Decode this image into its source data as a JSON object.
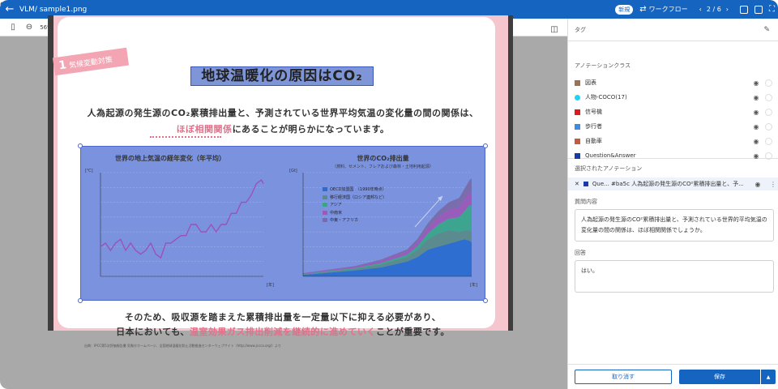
{
  "topbar": {
    "title": "VLM/ sample1.png",
    "badge": "新規",
    "workflow": "ワークフロー",
    "pager": "2 / 6",
    "back_icon": "arrow-left-icon"
  },
  "toolbar": {
    "zoom": "56%"
  },
  "document": {
    "ribbon_num": "1",
    "ribbon_text": "気候変動対策",
    "title": "地球温暖化の原因はCO₂",
    "lead_line1": "人為起源の発生源のCO₂累積排出量と、予測されている世界平均気温の変化量の間の関係は、",
    "lead_line2_highlight": "ほぼ相関関係",
    "lead_line2_rest": "にあることが明らかになっています。",
    "bottom_line1": "そのため、吸収源を踏まえた累積排出量を一定量以下に抑える必要があり、",
    "bottom_line2_pre": "日本においても、",
    "bottom_line2_highlight": "温室効果ガス排出削減を継続的に進めていく",
    "bottom_line2_post": "ことが重要です。",
    "source": "出典：IPCC第5次評価報告書 気象庁ホームページ、全国地球温暖化防止活動推進センターウェブサイト（http://www.jccca.org/）より",
    "highlight_color": "#e2708a"
  },
  "chart_data": [
    {
      "type": "line",
      "title": "世界の地上気温の経年変化（年平均）",
      "unit": "[℃]",
      "xunit": "[年]",
      "x_ticks": [
        "1850",
        "1900",
        "1950",
        "2000"
      ],
      "y_ticks": [
        "0.6",
        "0.4",
        "0.2",
        "0",
        "-0.2",
        "-0.4",
        "-0.6",
        "-0.8"
      ],
      "xlim": [
        1850,
        2012
      ],
      "ylim": [
        -0.8,
        0.6
      ],
      "series": [
        {
          "x": [
            1850,
            1855,
            1860,
            1865,
            1870,
            1875,
            1880,
            1885,
            1890,
            1895,
            1900,
            1905,
            1910,
            1915,
            1920,
            1925,
            1930,
            1935,
            1940,
            1945,
            1950,
            1955,
            1960,
            1965,
            1970,
            1975,
            1980,
            1985,
            1990,
            1995,
            2000,
            2005,
            2010,
            2012
          ],
          "y": [
            -0.4,
            -0.35,
            -0.45,
            -0.35,
            -0.3,
            -0.45,
            -0.35,
            -0.45,
            -0.5,
            -0.45,
            -0.35,
            -0.5,
            -0.55,
            -0.35,
            -0.35,
            -0.3,
            -0.25,
            -0.25,
            -0.1,
            -0.1,
            -0.2,
            -0.2,
            -0.1,
            -0.2,
            -0.1,
            -0.1,
            0.05,
            0.05,
            0.2,
            0.2,
            0.3,
            0.45,
            0.5,
            0.45
          ]
        }
      ]
    },
    {
      "type": "area",
      "title": "世界のCO₂排出量",
      "subtitle": "（燃料、セメント、フレアおよび森林・土地利用起源）",
      "unit": "[Gt]",
      "xunit": "[年]",
      "x_ticks": [
        "1850",
        "1900",
        "1950",
        "2000"
      ],
      "y_ticks": [
        "35",
        "30",
        "25",
        "20",
        "15",
        "10",
        "5",
        "0"
      ],
      "xlim": [
        1850,
        2012
      ],
      "ylim": [
        0,
        35
      ],
      "x": [
        1850,
        1900,
        1925,
        1950,
        1960,
        1970,
        1980,
        1990,
        2000,
        2005,
        2010,
        2012
      ],
      "series": [
        {
          "name": "OECD加盟国　（1990年時点）",
          "color": "#2a6ccf",
          "values": [
            0.5,
            2,
            3,
            5,
            6.5,
            9,
            10,
            11,
            12,
            12.5,
            12,
            11.5
          ]
        },
        {
          "name": "移行経済国（ロシア連邦など）",
          "color": "#5a8a8a",
          "values": [
            0.2,
            0.5,
            1,
            1.5,
            2.5,
            3.5,
            4.5,
            4.5,
            3,
            3,
            3.5,
            3.5
          ]
        },
        {
          "name": "アジア",
          "color": "#3aa58a",
          "values": [
            0.1,
            0.3,
            0.5,
            0.8,
            1.2,
            2,
            3,
            4,
            5,
            6.5,
            8.5,
            9
          ]
        },
        {
          "name": "中南米",
          "color": "#9a5ab8",
          "values": [
            0.2,
            0.5,
            0.8,
            1.2,
            1.5,
            2,
            2.5,
            3,
            3.5,
            4,
            4.5,
            4.5
          ]
        },
        {
          "name": "中東・アフリカ",
          "color": "#7a6aa8",
          "values": [
            0.1,
            0.2,
            0.4,
            0.6,
            1,
            1.5,
            2,
            2.5,
            3,
            3.5,
            4,
            4.5
          ]
        }
      ]
    }
  ],
  "panel": {
    "tags_label": "タグ",
    "classes_label": "アノテーションクラス",
    "classes": [
      {
        "name": "図表",
        "color": "#a0714f",
        "round": false
      },
      {
        "name": "人物-COCO(17)",
        "color": "#22d3ee",
        "round": true
      },
      {
        "name": "信号機",
        "color": "#e01a1a",
        "round": false
      },
      {
        "name": "歩行者",
        "color": "#3f8be0",
        "round": false
      },
      {
        "name": "自動車",
        "color": "#c65a3a",
        "round": false
      },
      {
        "name": "Question&Answer",
        "color": "#1a3aa8",
        "round": false
      }
    ],
    "selected_label": "選択されたアノテーション",
    "selected_item": "Que...  #ba5c  人為起源の発生源のCO²累積排出量と、予...",
    "question_label": "質問内容",
    "question_text": "人為起源の発生源のCO²累積排出量と、予測されている世界的平均気温の変化量の間の関係は、ほぼ相関関係でしょうか。",
    "answer_label": "回答",
    "answer_text": "はい。",
    "cancel": "取り消す",
    "save": "保存"
  }
}
